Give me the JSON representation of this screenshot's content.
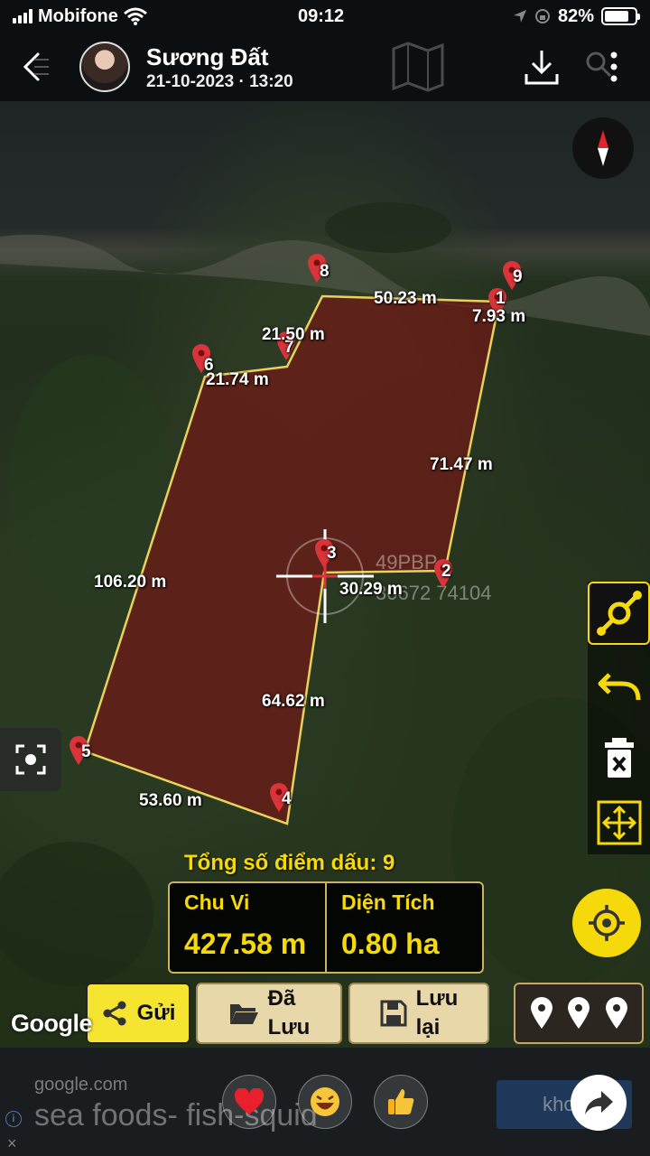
{
  "status_bar": {
    "carrier": "Mobifone",
    "time": "09:12",
    "battery": "82%",
    "battery_level": 0.82
  },
  "header": {
    "title": "Sương Đất",
    "subtitle": "21-10-2023 · 13:20"
  },
  "map": {
    "distances": {
      "d8_1": "50.23 m",
      "d1_9": "7.93 m",
      "d7_8": "21.50 m",
      "d6_7": "21.74 m",
      "d1_2": "71.47 m",
      "d5_6": "106.20 m",
      "d2_3": "30.29 m",
      "d3_4": "64.62 m",
      "d4_5": "53.60 m"
    },
    "points": [
      "1",
      "2",
      "3",
      "4",
      "5",
      "6",
      "7",
      "8",
      "9"
    ],
    "watermark_line1": "49PBP",
    "watermark_line2": "30672  74104",
    "attribution": "Google"
  },
  "summary": {
    "total_label": "Tổng số điểm dấu: 9",
    "perimeter_label": "Chu Vi",
    "perimeter_value": "427.58 m",
    "area_label": "Diện Tích",
    "area_value": "0.80 ha"
  },
  "actions": {
    "send": "Gửi",
    "saved_line1": "Đã",
    "saved_line2": "Lưu",
    "save_line1": "Lưu",
    "save_line2": "lại"
  },
  "ad": {
    "domain": "google.com",
    "text": "sea foods- fish-squid",
    "cta": "khoẻ",
    "info": "i",
    "close": "×"
  },
  "colors": {
    "accent": "#f5d90a",
    "plot_fill": "#7a1414",
    "plot_border": "#e8d25a",
    "pin": "#d9343a"
  }
}
